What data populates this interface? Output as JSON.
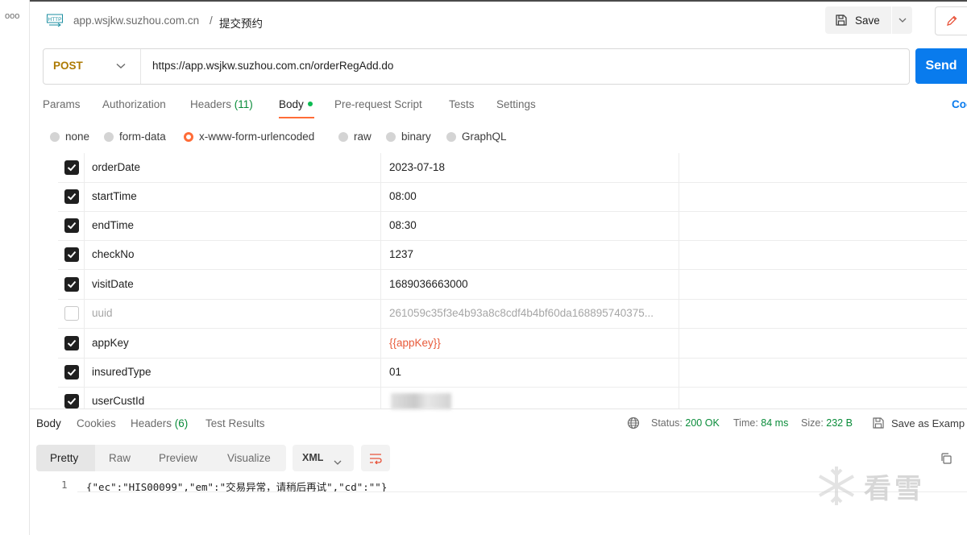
{
  "header": {
    "icon_text": "HTTP",
    "breadcrumb_host": "app.wsjkw.suzhou.com.cn",
    "breadcrumb_sep": "/",
    "request_name": "提交预约",
    "save_label": "Save"
  },
  "request": {
    "method": "POST",
    "url": "https://app.wsjkw.suzhou.com.cn/orderRegAdd.do",
    "send_label": "Send"
  },
  "request_tabs": [
    {
      "label": "Params"
    },
    {
      "label": "Authorization"
    },
    {
      "label": "Headers",
      "count": "(11)"
    },
    {
      "label": "Body"
    },
    {
      "label": "Pre-request Script"
    },
    {
      "label": "Tests"
    },
    {
      "label": "Settings"
    }
  ],
  "code_link": "Coo",
  "body_types": [
    {
      "label": "none",
      "selected": false
    },
    {
      "label": "form-data",
      "selected": false
    },
    {
      "label": "x-www-form-urlencoded",
      "selected": true
    },
    {
      "label": "raw",
      "selected": false
    },
    {
      "label": "binary",
      "selected": false
    },
    {
      "label": "GraphQL",
      "selected": false
    }
  ],
  "params": [
    {
      "key": "orderDate",
      "value": "2023-07-18",
      "checked": true
    },
    {
      "key": "startTime",
      "value": "08:00",
      "checked": true
    },
    {
      "key": "endTime",
      "value": "08:30",
      "checked": true
    },
    {
      "key": "checkNo",
      "value": "1237",
      "checked": true
    },
    {
      "key": "visitDate",
      "value": "1689036663000",
      "checked": true
    },
    {
      "key": "uuid",
      "value": "261059c35f3e4b93a8c8cdf4b4bf60da168895740375...",
      "checked": false
    },
    {
      "key": "appKey",
      "value": "{{appKey}}",
      "checked": true
    },
    {
      "key": "insuredType",
      "value": "01",
      "checked": true
    },
    {
      "key": "userCustId",
      "value": "",
      "checked": true
    }
  ],
  "response_tabs": [
    {
      "label": "Body"
    },
    {
      "label": "Cookies"
    },
    {
      "label": "Headers",
      "count": "(6)"
    },
    {
      "label": "Test Results"
    }
  ],
  "status": {
    "status_label": "Status:",
    "status_value": "200 OK",
    "time_label": "Time:",
    "time_value": "84 ms",
    "size_label": "Size:",
    "size_value": "232 B",
    "save_example": "Save as Examp"
  },
  "view_modes": [
    "Pretty",
    "Raw",
    "Preview",
    "Visualize"
  ],
  "format": "XML",
  "response_line_no": "1",
  "response_body": "{\"ec\":\"HIS00099\",\"em\":\"交易异常，请稍后再试\",\"cd\":\"\"}",
  "watermark": "看雪",
  "colors": {
    "accent": "#ff6c37",
    "send": "#097bed",
    "status_ok": "#0a8c3a",
    "method_post": "#ad7a03"
  }
}
